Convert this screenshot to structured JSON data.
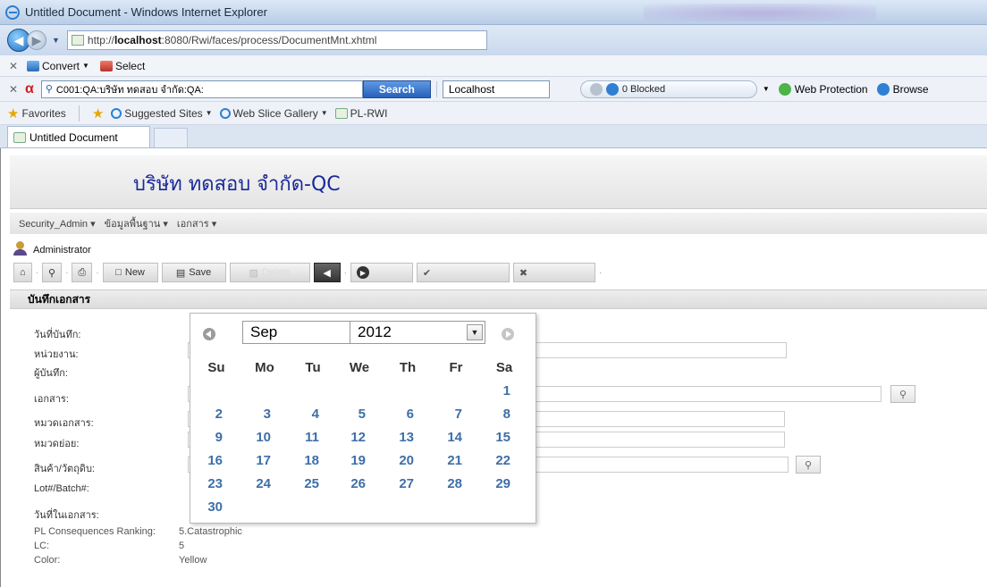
{
  "window": {
    "title": "Untitled Document - Windows Internet Explorer",
    "url_prefix": "http://",
    "url_host": "localhost",
    "url_rest": ":8080/Rwi/faces/process/DocumentMnt.xhtml"
  },
  "toolbar1": {
    "convert": "Convert",
    "select": "Select"
  },
  "toolbar2": {
    "search_text": "C001:QA:บริษัท ทดสอบ จำกัด:QA:",
    "search_button": "Search",
    "localhost": "Localhost",
    "blocked": "0 Blocked",
    "web_protection": "Web Protection",
    "browse": "Browse"
  },
  "favorites": {
    "label": "Favorites",
    "suggested": "Suggested Sites",
    "web_slice": "Web Slice Gallery",
    "pl_rwi": "PL-RWI"
  },
  "tab": {
    "label": "Untitled Document"
  },
  "app": {
    "company": "บริษัท ทดสอบ จำกัด-QC",
    "menu": [
      "Security_Admin",
      "ข้อมูลพื้นฐาน",
      "เอกสาร"
    ],
    "user": "Administrator",
    "actions": {
      "new": "New",
      "save": "Save",
      "delete": "Delete"
    },
    "section_title": "บันทึกเอกสาร"
  },
  "form": {
    "labels": {
      "record_date": "วันที่บันทึก:",
      "department": "หน่วยงาน:",
      "recorder": "ผู้บันทึก:",
      "document": "เอกสาร:",
      "doc_category": "หมวดเอกสาร:",
      "subcategory": "หมวดย่อย:",
      "product": "สินค้า/วัตถุดิบ:",
      "lot": "Lot#/Batch#:",
      "doc_date": "วันที่ในเอกสาร:"
    },
    "info": [
      {
        "label": "PL Consequences Ranking:",
        "value": "5.Catastrophic"
      },
      {
        "label": "LC:",
        "value": "5"
      },
      {
        "label": "Color:",
        "value": "Yellow"
      }
    ]
  },
  "calendar": {
    "month": "Sep",
    "year": "2012",
    "weekdays": [
      "Su",
      "Mo",
      "Tu",
      "We",
      "Th",
      "Fr",
      "Sa"
    ],
    "days": [
      "1",
      "2",
      "3",
      "4",
      "5",
      "6",
      "7",
      "8",
      "9",
      "10",
      "11",
      "12",
      "13",
      "14",
      "15",
      "16",
      "17",
      "18",
      "19",
      "20",
      "21",
      "22",
      "23",
      "24",
      "25",
      "26",
      "27",
      "28",
      "29",
      "30"
    ],
    "first_weekday_index": 6
  },
  "colors": {
    "company_text": "#1a2a9a",
    "calendar_day": "#3e6fa8",
    "search_button": "#2860b8"
  }
}
